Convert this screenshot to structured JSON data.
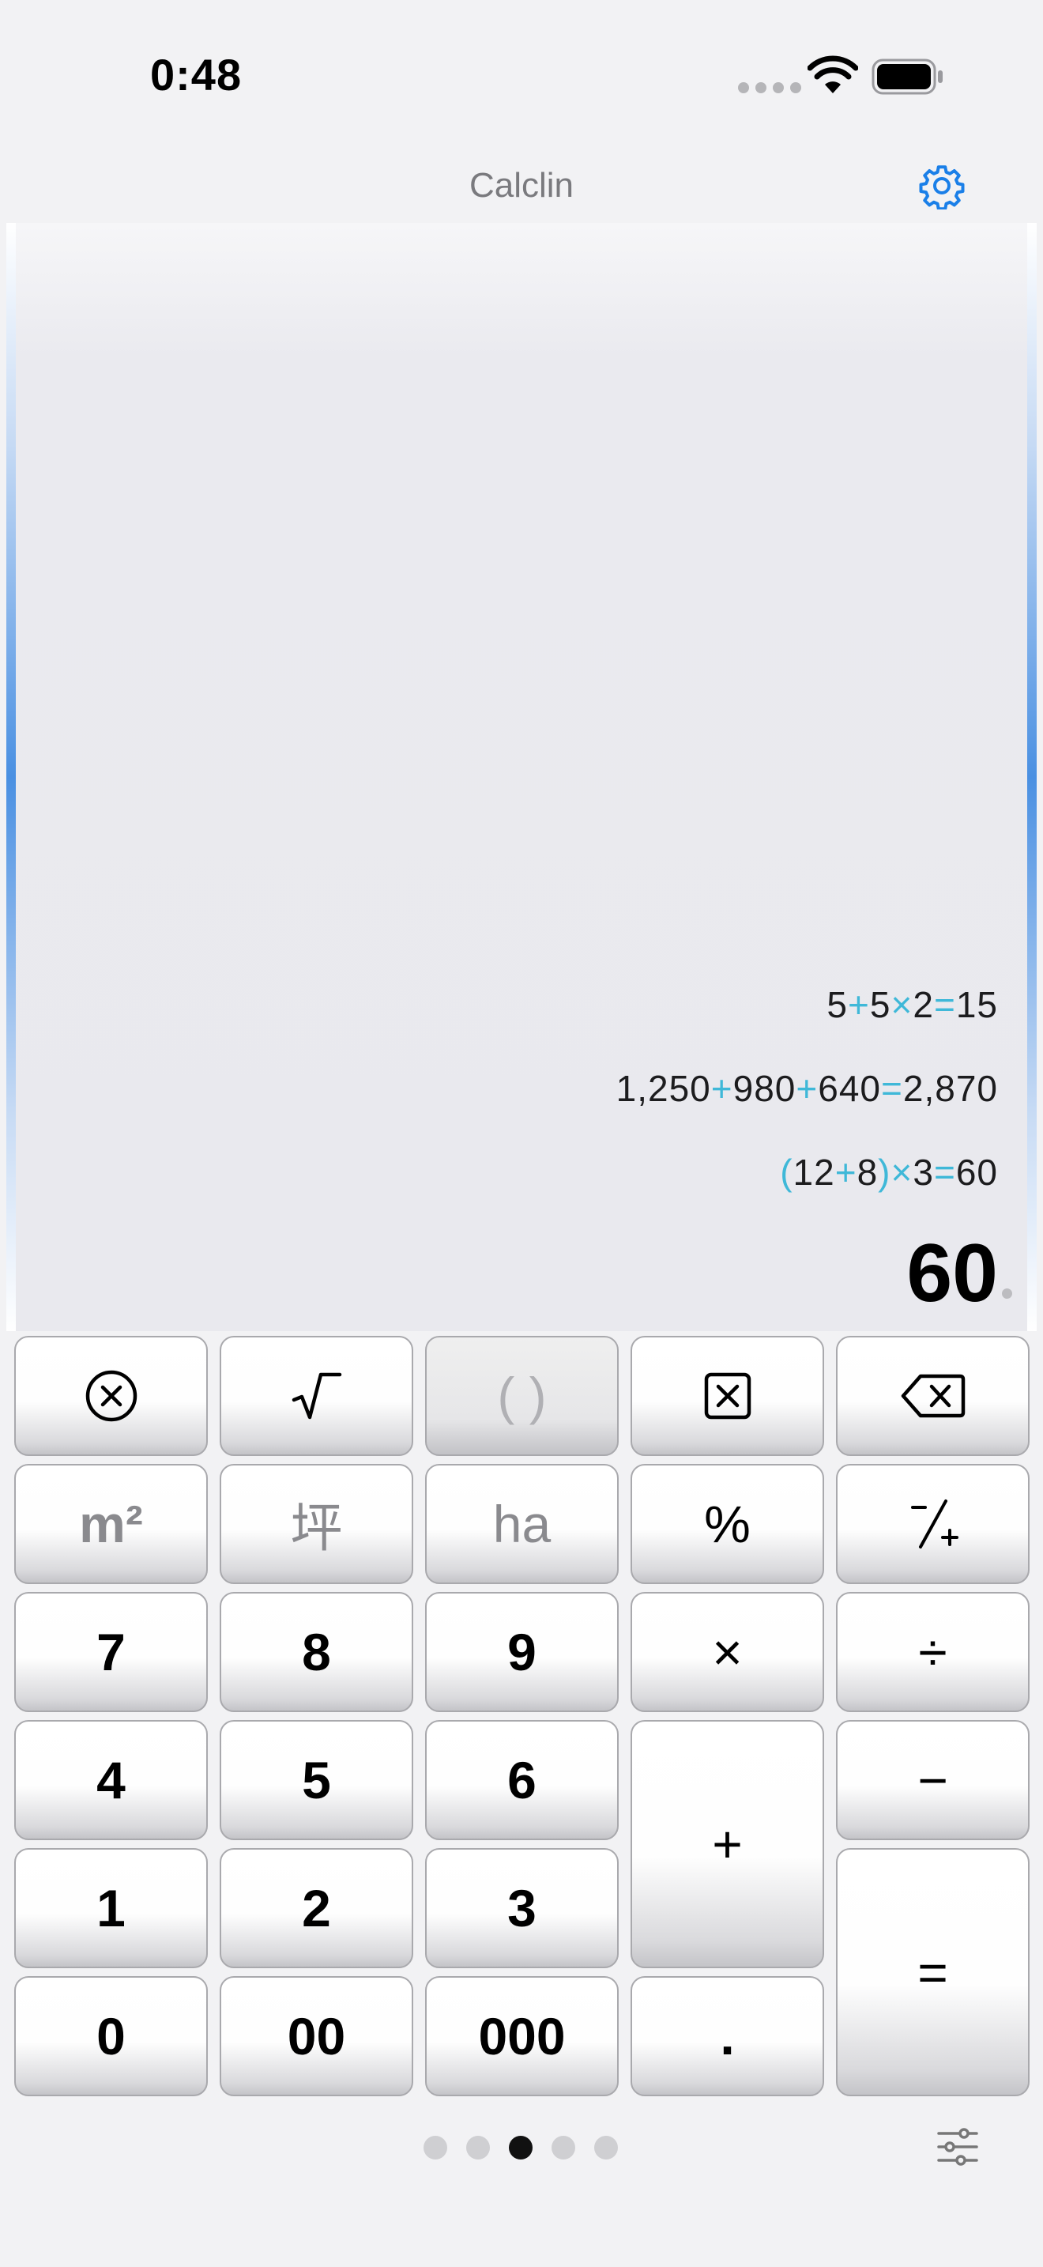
{
  "status": {
    "time": "0:48"
  },
  "nav": {
    "title": "Calclin"
  },
  "tape": [
    {
      "parts": [
        {
          "t": "5",
          "op": false
        },
        {
          "t": "+",
          "op": true
        },
        {
          "t": "5",
          "op": false
        },
        {
          "t": "×",
          "op": true
        },
        {
          "t": "2",
          "op": false
        },
        {
          "t": "=",
          "op": true
        },
        {
          "t": "15",
          "op": false
        }
      ]
    },
    {
      "parts": [
        {
          "t": "1,250",
          "op": false
        },
        {
          "t": "+",
          "op": true
        },
        {
          "t": "980",
          "op": false
        },
        {
          "t": "+",
          "op": true
        },
        {
          "t": "640",
          "op": false
        },
        {
          "t": "=",
          "op": true
        },
        {
          "t": "2,870",
          "op": false
        }
      ]
    },
    {
      "parts": [
        {
          "t": "(",
          "op": true
        },
        {
          "t": "12",
          "op": false
        },
        {
          "t": "+",
          "op": true
        },
        {
          "t": "8",
          "op": false
        },
        {
          "t": ")",
          "op": true
        },
        {
          "t": "×",
          "op": true
        },
        {
          "t": "3",
          "op": false
        },
        {
          "t": "=",
          "op": true
        },
        {
          "t": "60",
          "op": false
        }
      ]
    }
  ],
  "result": "60",
  "keys": {
    "clear_icon": "circle-x-icon",
    "sqrt": "√‾",
    "parens": "( )",
    "clear_entry_icon": "square-x-icon",
    "backspace_icon": "backspace-icon",
    "sqm": "m²",
    "tsubo": "坪",
    "hectare": "ha",
    "percent": "%",
    "sign": "⁻∕₊",
    "seven": "7",
    "eight": "8",
    "nine": "9",
    "multiply": "×",
    "divide": "÷",
    "four": "4",
    "five": "5",
    "six": "6",
    "plus": "+",
    "minus": "−",
    "one": "1",
    "two": "2",
    "three": "3",
    "equals": "=",
    "zero": "0",
    "double_zero": "00",
    "triple_zero": "000",
    "decimal": "."
  },
  "pager": {
    "count": 5,
    "active": 3
  },
  "colors": {
    "accent": "#3fb8d8",
    "gear": "#1a7fe8"
  }
}
